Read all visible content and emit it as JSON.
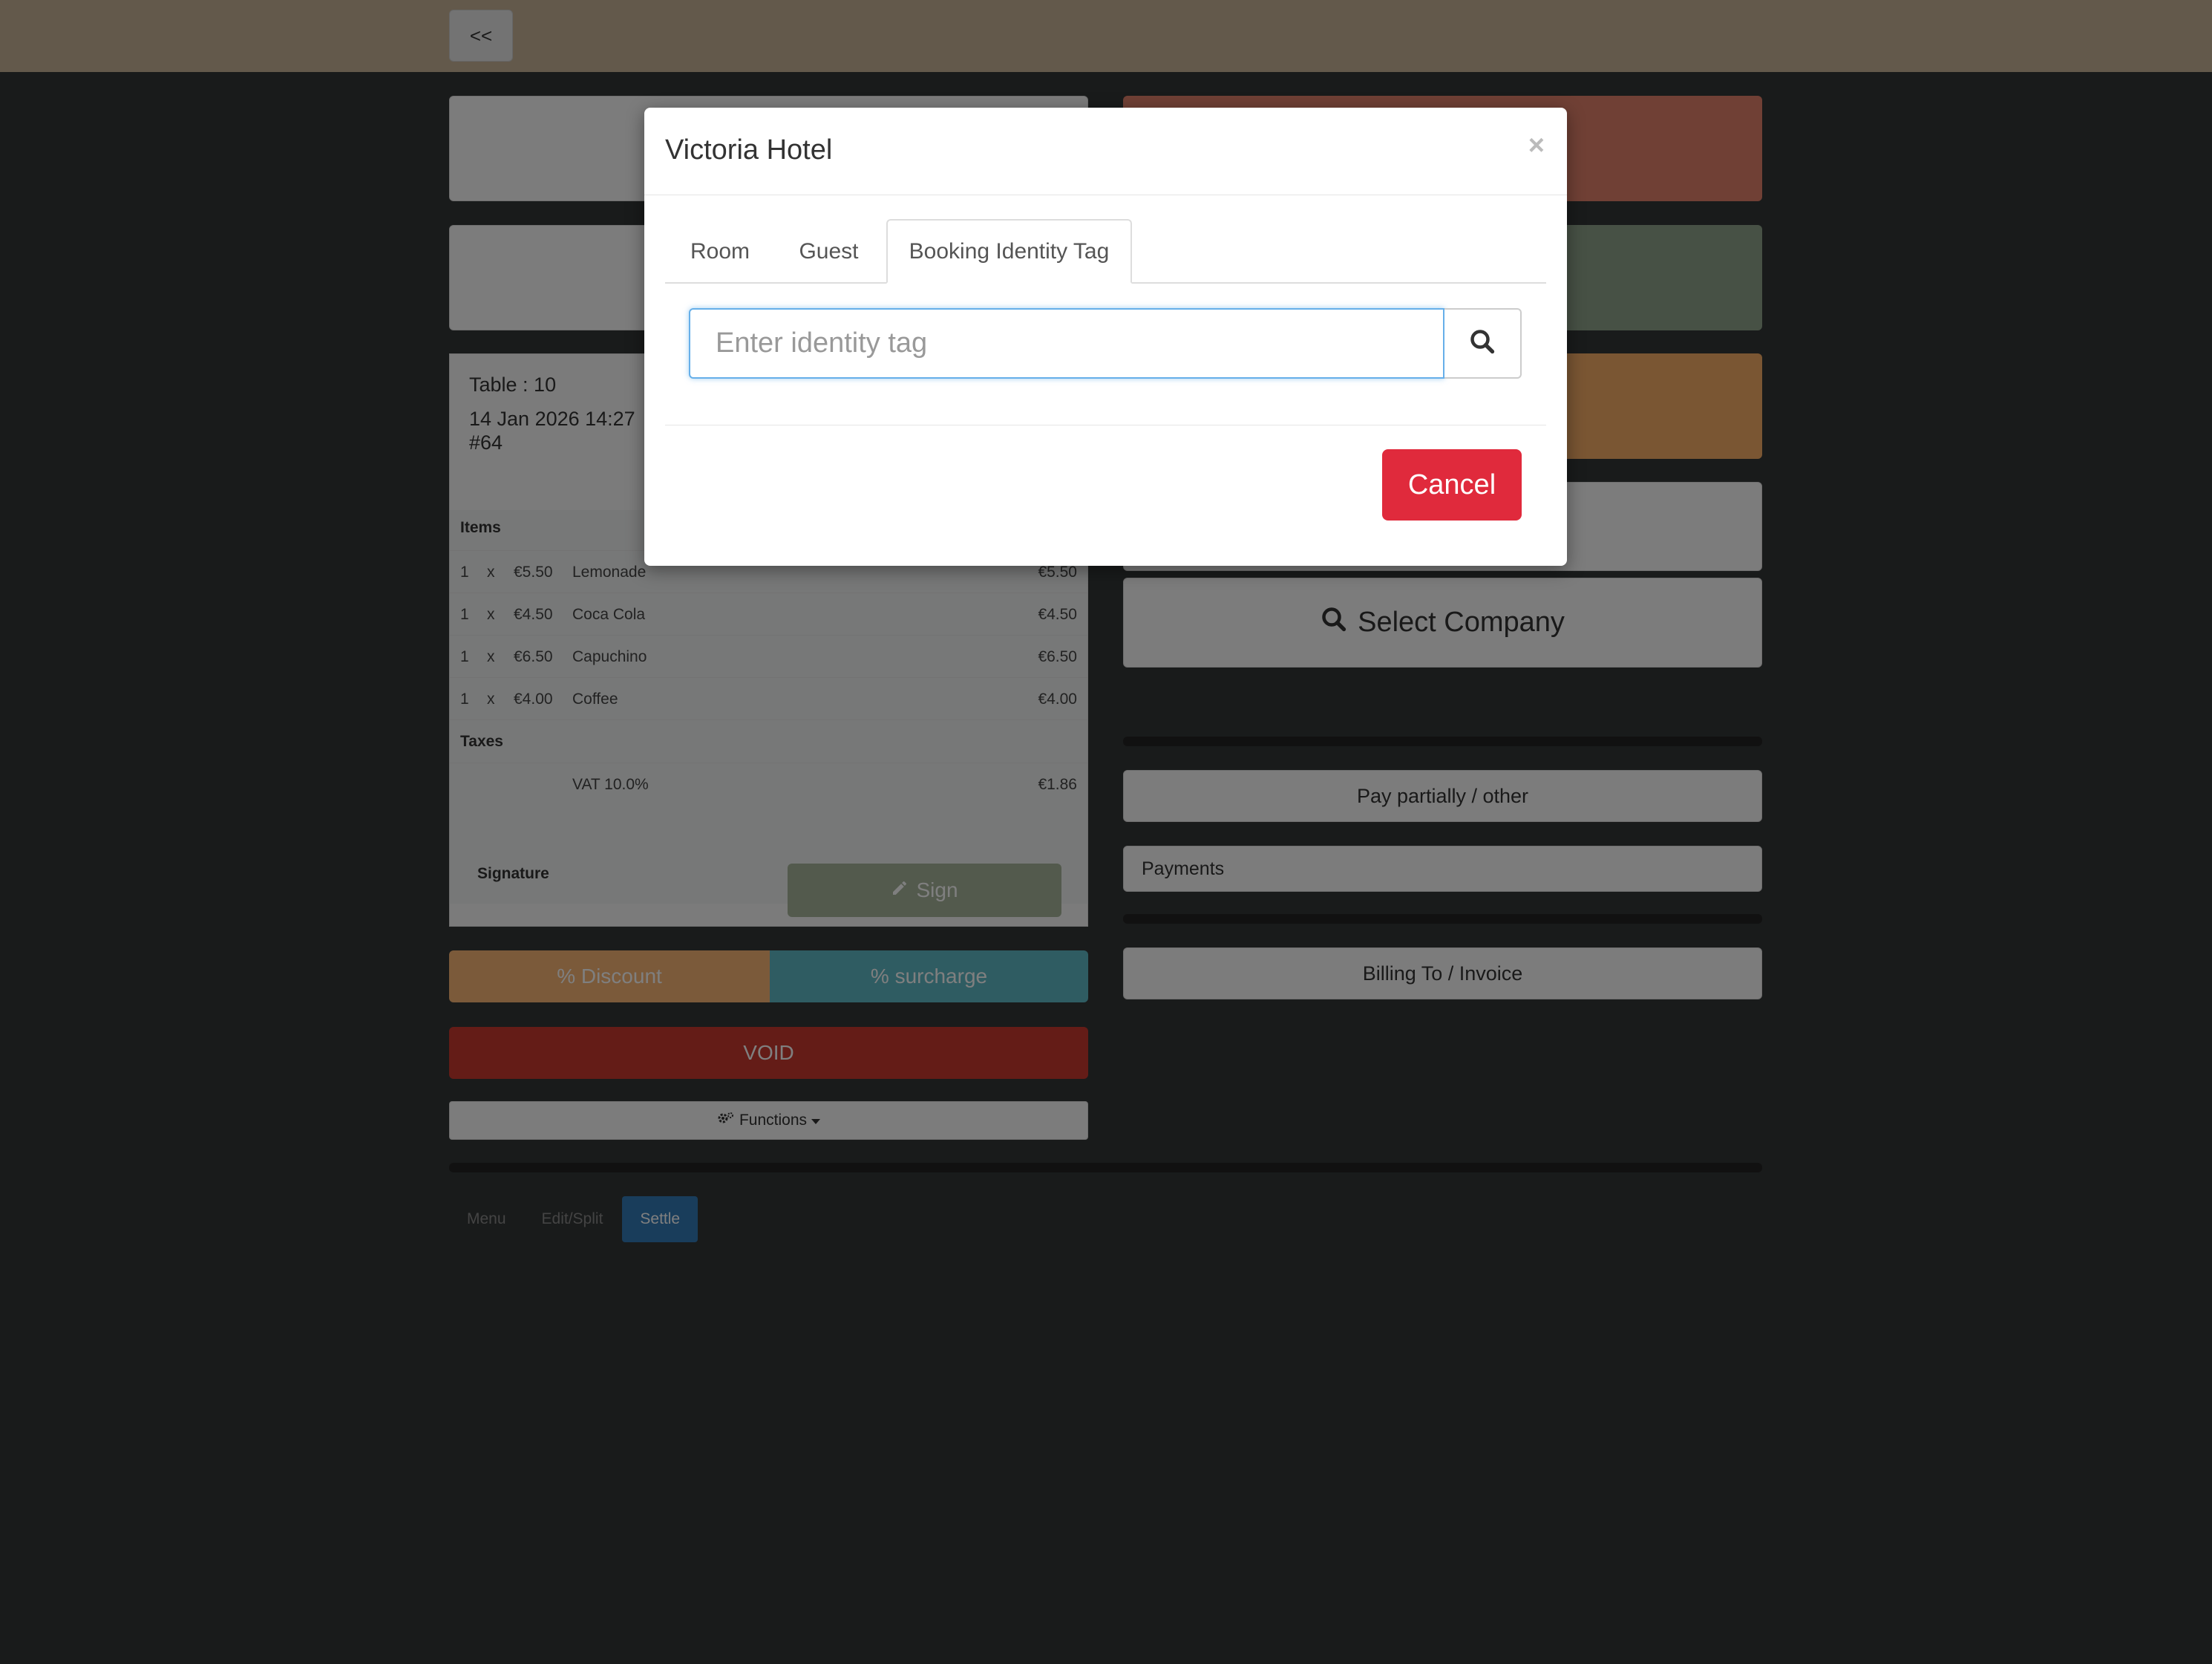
{
  "topbar": {
    "back_label": "<<"
  },
  "receipt": {
    "table_label": "Table : 10",
    "date": "14 Jan 2026 14:27",
    "order_no": "#64",
    "items_header": "Items",
    "items": [
      {
        "qty": "1",
        "x": "x",
        "unit": "€5.50",
        "name": "Lemonade",
        "total": "€5.50"
      },
      {
        "qty": "1",
        "x": "x",
        "unit": "€4.50",
        "name": "Coca Cola",
        "total": "€4.50"
      },
      {
        "qty": "1",
        "x": "x",
        "unit": "€6.50",
        "name": "Capuchino",
        "total": "€6.50"
      },
      {
        "qty": "1",
        "x": "x",
        "unit": "€4.00",
        "name": "Coffee",
        "total": "€4.00"
      }
    ],
    "taxes_header": "Taxes",
    "tax": {
      "name": "VAT 10.0%",
      "total": "€1.86"
    },
    "signature_label": "Signature",
    "sign_label": "Sign"
  },
  "actions": {
    "discount_label": "% Discount",
    "surcharge_label": "% surcharge",
    "void_label": "VOID",
    "functions_label": "Functions"
  },
  "right": {
    "select_company_label": "Select Company",
    "pay_partially_label": "Pay partially / other",
    "payments_label": "Payments",
    "billing_label": "Billing To / Invoice"
  },
  "bottom_tabs": [
    {
      "label": "Menu"
    },
    {
      "label": "Edit/Split"
    },
    {
      "label": "Settle"
    }
  ],
  "modal": {
    "title": "Victoria Hotel",
    "close_label": "×",
    "tabs": [
      {
        "label": "Room"
      },
      {
        "label": "Guest"
      },
      {
        "label": "Booking Identity Tag"
      }
    ],
    "active_tab": "Booking Identity Tag",
    "search_placeholder": "Enter identity tag",
    "search_value": "",
    "cancel_label": "Cancel"
  },
  "colors": {
    "topbar": "#c6b396",
    "salmon": "#e0806a",
    "green": "#8fa38a",
    "orange": "#f5ad66",
    "discount": "#f7b574",
    "surcharge": "#5fb8c4",
    "void": "#c8382f",
    "cancel": "#e02a3c",
    "settle_active": "#337ab7"
  },
  "icons": [
    "search-icon",
    "pencil-icon",
    "gears-icon",
    "caret-down-icon",
    "close-icon"
  ]
}
